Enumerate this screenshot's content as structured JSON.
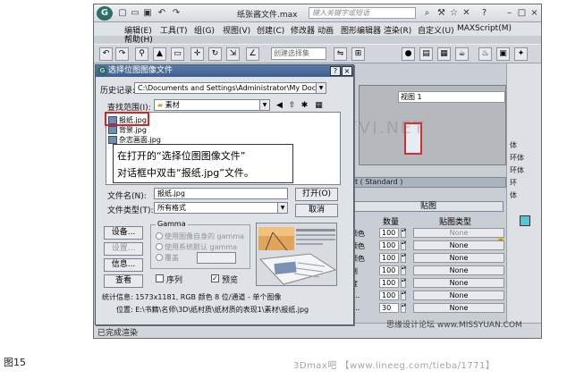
{
  "app": {
    "logo_glyph": "G",
    "doc_title": "纸张酱文件.max",
    "search_placeholder": "键入关键字或短语",
    "menus": [
      "编辑(E)",
      "工具(T)",
      "组(G)",
      "视图(V)",
      "创建(C)",
      "修改器",
      "动画",
      "图形编辑器",
      "渲染(R)",
      "自定义(U)",
      "MAXScript(M)"
    ],
    "help_menu": "帮助(H)",
    "selection_set_placeholder": "创建选择集",
    "viewport_label": "视图 1",
    "status_text": "已完成渲染"
  },
  "right_panel": {
    "items": [
      "体",
      "环体",
      "环体",
      "环",
      "体"
    ]
  },
  "material": {
    "header": "t ( Standard )",
    "map_title": "贴图",
    "col_amount": "数量",
    "col_maptype": "贴图类型",
    "rows": [
      {
        "label": "颜色",
        "amount": "100",
        "map": "None",
        "enabled": false
      },
      {
        "label": "颜色",
        "amount": "100",
        "map": "None",
        "enabled": true
      },
      {
        "label": "颜色",
        "amount": "100",
        "map": "None",
        "enabled": true
      },
      {
        "label": "别",
        "amount": "100",
        "map": "None",
        "enabled": true
      },
      {
        "label": "度",
        "amount": "100",
        "map": "None",
        "enabled": true
      },
      {
        "label": "....",
        "amount": "100",
        "map": "None",
        "enabled": true
      },
      {
        "label": "....",
        "amount": "30",
        "map": "None",
        "enabled": true
      },
      {
        "label": "....",
        "amount": "100",
        "map": "None",
        "enabled": true
      },
      {
        "label": "....",
        "amount": "100",
        "map": "None",
        "enabled": true
      }
    ]
  },
  "dialog": {
    "title": "选择位图图像文件",
    "help_btn": "?",
    "close_btn": "×",
    "history_label": "历史记录:",
    "history_value": "C:\\Documents and Settings\\Administrator\\My Documents\\3dsMax\\",
    "lookin_label": "查找范围(I):",
    "lookin_value": "素材",
    "files": [
      "报纸.jpg",
      "背景.jpg",
      "杂志画面.jpg"
    ],
    "filename_label": "文件名(N):",
    "filename_value": "报纸.jpg",
    "filetype_label": "文件类型(T):",
    "filetype_value": "所有格式",
    "open_btn": "打开(O)",
    "cancel_btn": "取消",
    "setup_btn": "设备...",
    "settings_btn": "设置...",
    "info_btn": "信息...",
    "view_btn": "查看",
    "gamma_label": "Gamma",
    "gamma_opts": [
      "使用图像自身的 gamma",
      "使用系统默认 gamma",
      "覆盖"
    ],
    "sequence_label": "序列",
    "preview_label": "预览",
    "stats": "统计信息: 1573x1181, RGB 颜色 8 位/通道 - 单个图像",
    "location": "位置: E:\\书籍\\名师\\3D\\纸村质\\纸材质的表现1\\素材\\报纸.jpg"
  },
  "callout": {
    "line1": "在打开的“选择位图图像文件”",
    "line2": "对话框中双击“报纸.jpg”文件。"
  },
  "watermarks": {
    "center": "騰龍視覺 WWW.TTVI.NET",
    "bottom_right": "思缘设计论坛 www.MISSYUAN.COM"
  },
  "caption": "图15",
  "credit": "3Dmax吧 【www.lineeg.com/tieba/1771】"
}
